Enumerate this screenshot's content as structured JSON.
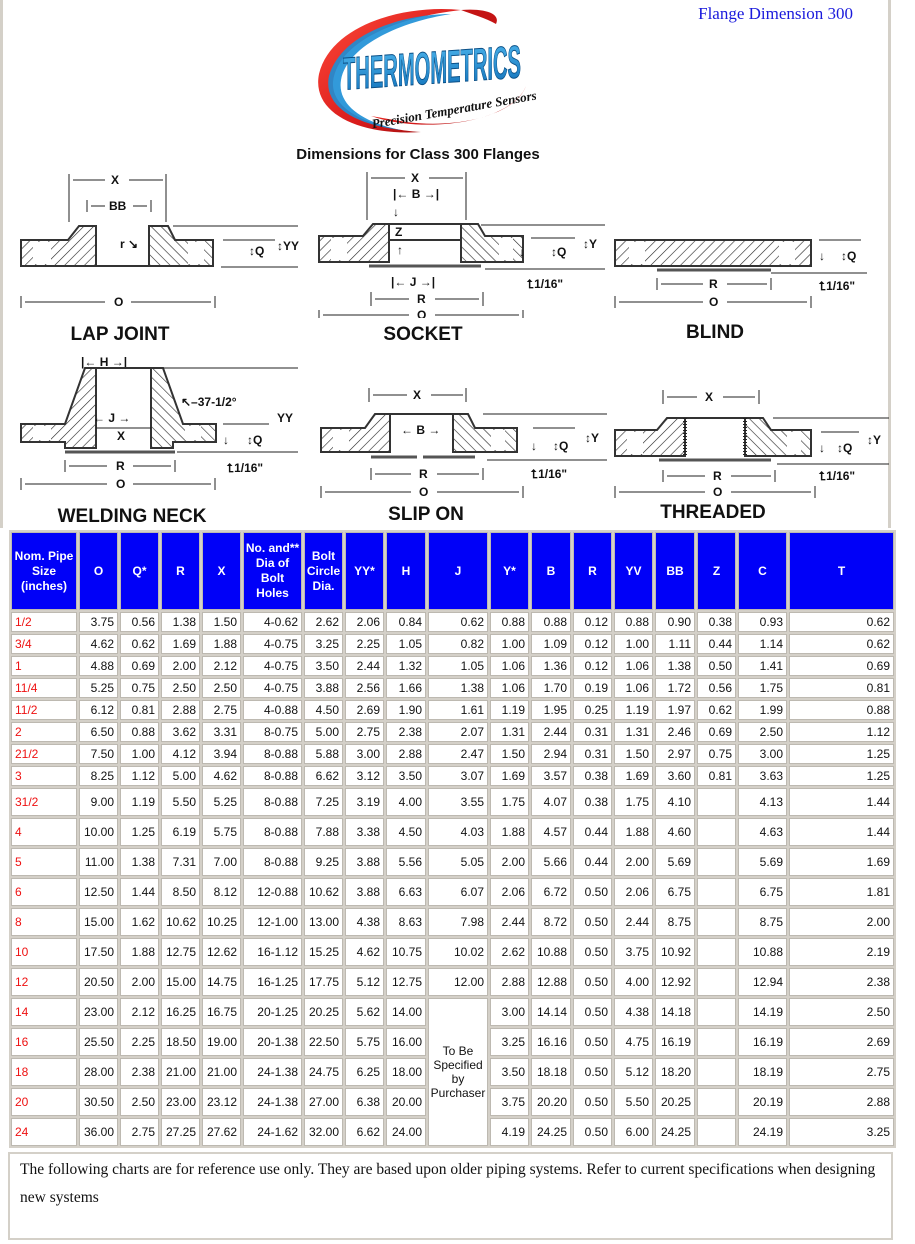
{
  "page_title": "Flange Dimension 300",
  "logo": {
    "brand": "THERMOMETRICS",
    "tagline": "Precision Temperature Sensors",
    "colors": {
      "swoosh": "#e32222",
      "swoosh_inner": "#1c8fd6",
      "text": "#1b8fd8"
    }
  },
  "subtitle": "Dimensions for Class 300 Flanges",
  "diagrams": [
    {
      "label": "LAP JOINT",
      "dims": [
        "X",
        "BB",
        "r",
        "Q",
        "YY",
        "O"
      ]
    },
    {
      "label": "SOCKET",
      "dims": [
        "X",
        "B",
        "Z",
        "J",
        "R",
        "O",
        "Q",
        "Y",
        "1/16\""
      ]
    },
    {
      "label": "BLIND",
      "dims": [
        "R",
        "O",
        "Q",
        "1/16\""
      ]
    },
    {
      "label": "WELDING NECK",
      "dims": [
        "H",
        "37-1/2°",
        "J",
        "X",
        "YY",
        "Q",
        "R",
        "O",
        "1/16\""
      ]
    },
    {
      "label": "SLIP ON",
      "dims": [
        "X",
        "B",
        "R",
        "O",
        "Q",
        "Y",
        "1/16\""
      ]
    },
    {
      "label": "THREADED",
      "dims": [
        "X",
        "R",
        "O",
        "Q",
        "Y",
        "1/16\""
      ]
    }
  ],
  "table": {
    "header_color": "#0000f8",
    "size_color": "#ee1111",
    "columns": [
      "Nom. Pipe Size (inches)",
      "O",
      "Q*",
      "R",
      "X",
      "No. and** Dia of Bolt Holes",
      "Bolt Circle Dia.",
      "YY*",
      "H",
      "J",
      "Y*",
      "B",
      "R",
      "YV",
      "BB",
      "Z",
      "C",
      "T"
    ],
    "j_merged_note": "To Be Specified by Purchaser",
    "rows": [
      [
        "1/2",
        "3.75",
        "0.56",
        "1.38",
        "1.50",
        "4-0.62",
        "2.62",
        "2.06",
        "0.84",
        "0.62",
        "0.88",
        "0.88",
        "0.12",
        "0.88",
        "0.90",
        "0.38",
        "0.93",
        "0.62"
      ],
      [
        "3/4",
        "4.62",
        "0.62",
        "1.69",
        "1.88",
        "4-0.75",
        "3.25",
        "2.25",
        "1.05",
        "0.82",
        "1.00",
        "1.09",
        "0.12",
        "1.00",
        "1.11",
        "0.44",
        "1.14",
        "0.62"
      ],
      [
        "1",
        "4.88",
        "0.69",
        "2.00",
        "2.12",
        "4-0.75",
        "3.50",
        "2.44",
        "1.32",
        "1.05",
        "1.06",
        "1.36",
        "0.12",
        "1.06",
        "1.38",
        "0.50",
        "1.41",
        "0.69"
      ],
      [
        "11/4",
        "5.25",
        "0.75",
        "2.50",
        "2.50",
        "4-0.75",
        "3.88",
        "2.56",
        "1.66",
        "1.38",
        "1.06",
        "1.70",
        "0.19",
        "1.06",
        "1.72",
        "0.56",
        "1.75",
        "0.81"
      ],
      [
        "11/2",
        "6.12",
        "0.81",
        "2.88",
        "2.75",
        "4-0.88",
        "4.50",
        "2.69",
        "1.90",
        "1.61",
        "1.19",
        "1.95",
        "0.25",
        "1.19",
        "1.97",
        "0.62",
        "1.99",
        "0.88"
      ],
      [
        "2",
        "6.50",
        "0.88",
        "3.62",
        "3.31",
        "8-0.75",
        "5.00",
        "2.75",
        "2.38",
        "2.07",
        "1.31",
        "2.44",
        "0.31",
        "1.31",
        "2.46",
        "0.69",
        "2.50",
        "1.12"
      ],
      [
        "21/2",
        "7.50",
        "1.00",
        "4.12",
        "3.94",
        "8-0.88",
        "5.88",
        "3.00",
        "2.88",
        "2.47",
        "1.50",
        "2.94",
        "0.31",
        "1.50",
        "2.97",
        "0.75",
        "3.00",
        "1.25"
      ],
      [
        "3",
        "8.25",
        "1.12",
        "5.00",
        "4.62",
        "8-0.88",
        "6.62",
        "3.12",
        "3.50",
        "3.07",
        "1.69",
        "3.57",
        "0.38",
        "1.69",
        "3.60",
        "0.81",
        "3.63",
        "1.25"
      ],
      [
        "31/2",
        "9.00",
        "1.19",
        "5.50",
        "5.25",
        "8-0.88",
        "7.25",
        "3.19",
        "4.00",
        "3.55",
        "1.75",
        "4.07",
        "0.38",
        "1.75",
        "4.10",
        "",
        "4.13",
        "1.44"
      ],
      [
        "4",
        "10.00",
        "1.25",
        "6.19",
        "5.75",
        "8-0.88",
        "7.88",
        "3.38",
        "4.50",
        "4.03",
        "1.88",
        "4.57",
        "0.44",
        "1.88",
        "4.60",
        "",
        "4.63",
        "1.44"
      ],
      [
        "5",
        "11.00",
        "1.38",
        "7.31",
        "7.00",
        "8-0.88",
        "9.25",
        "3.88",
        "5.56",
        "5.05",
        "2.00",
        "5.66",
        "0.44",
        "2.00",
        "5.69",
        "",
        "5.69",
        "1.69"
      ],
      [
        "6",
        "12.50",
        "1.44",
        "8.50",
        "8.12",
        "12-0.88",
        "10.62",
        "3.88",
        "6.63",
        "6.07",
        "2.06",
        "6.72",
        "0.50",
        "2.06",
        "6.75",
        "",
        "6.75",
        "1.81"
      ],
      [
        "8",
        "15.00",
        "1.62",
        "10.62",
        "10.25",
        "12-1.00",
        "13.00",
        "4.38",
        "8.63",
        "7.98",
        "2.44",
        "8.72",
        "0.50",
        "2.44",
        "8.75",
        "",
        "8.75",
        "2.00"
      ],
      [
        "10",
        "17.50",
        "1.88",
        "12.75",
        "12.62",
        "16-1.12",
        "15.25",
        "4.62",
        "10.75",
        "10.02",
        "2.62",
        "10.88",
        "0.50",
        "3.75",
        "10.92",
        "",
        "10.88",
        "2.19"
      ],
      [
        "12",
        "20.50",
        "2.00",
        "15.00",
        "14.75",
        "16-1.25",
        "17.75",
        "5.12",
        "12.75",
        "12.00",
        "2.88",
        "12.88",
        "0.50",
        "4.00",
        "12.92",
        "",
        "12.94",
        "2.38"
      ],
      [
        "14",
        "23.00",
        "2.12",
        "16.25",
        "16.75",
        "20-1.25",
        "20.25",
        "5.62",
        "14.00",
        null,
        "3.00",
        "14.14",
        "0.50",
        "4.38",
        "14.18",
        "",
        "14.19",
        "2.50"
      ],
      [
        "16",
        "25.50",
        "2.25",
        "18.50",
        "19.00",
        "20-1.38",
        "22.50",
        "5.75",
        "16.00",
        null,
        "3.25",
        "16.16",
        "0.50",
        "4.75",
        "16.19",
        "",
        "16.19",
        "2.69"
      ],
      [
        "18",
        "28.00",
        "2.38",
        "21.00",
        "21.00",
        "24-1.38",
        "24.75",
        "6.25",
        "18.00",
        null,
        "3.50",
        "18.18",
        "0.50",
        "5.12",
        "18.20",
        "",
        "18.19",
        "2.75"
      ],
      [
        "20",
        "30.50",
        "2.50",
        "23.00",
        "23.12",
        "24-1.38",
        "27.00",
        "6.38",
        "20.00",
        null,
        "3.75",
        "20.20",
        "0.50",
        "5.50",
        "20.25",
        "",
        "20.19",
        "2.88"
      ],
      [
        "24",
        "36.00",
        "2.75",
        "27.25",
        "27.62",
        "24-1.62",
        "32.00",
        "6.62",
        "24.00",
        null,
        "4.19",
        "24.25",
        "0.50",
        "6.00",
        "24.25",
        "",
        "24.19",
        "3.25"
      ]
    ]
  },
  "footnote": "The following charts are for reference use only. They are based upon older piping systems.  Refer to current specifications when designing new systems"
}
